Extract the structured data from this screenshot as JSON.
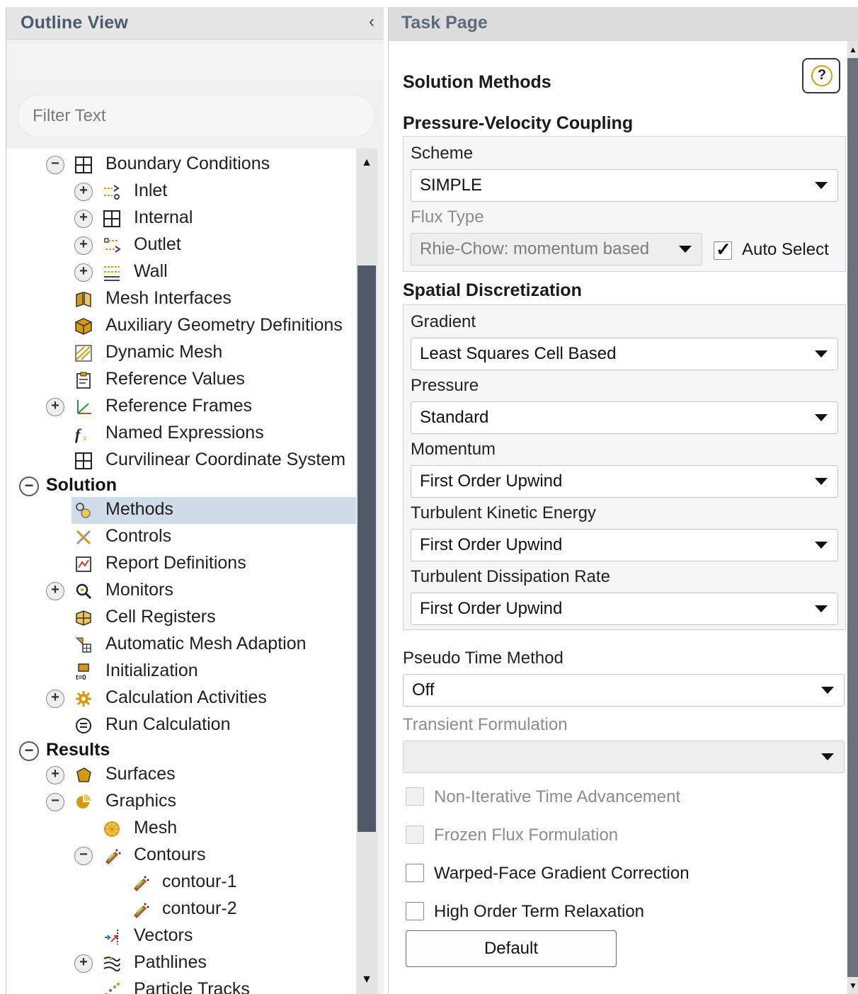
{
  "outline": {
    "title": "Outline View",
    "collapse_glyph": "‹",
    "filter_placeholder": "Filter Text",
    "tree": [
      {
        "label": "Boundary Conditions",
        "level": 1,
        "expander": "−",
        "icon": "grid-icon"
      },
      {
        "label": "Inlet",
        "level": 2,
        "expander": "+",
        "icon": "inlet-icon"
      },
      {
        "label": "Internal",
        "level": 2,
        "expander": "+",
        "icon": "grid-icon"
      },
      {
        "label": "Outlet",
        "level": 2,
        "expander": "+",
        "icon": "outlet-icon"
      },
      {
        "label": "Wall",
        "level": 2,
        "expander": "+",
        "icon": "wall-icon"
      },
      {
        "label": "Mesh Interfaces",
        "level": 1,
        "expander": "",
        "icon": "mesh-interfaces-icon"
      },
      {
        "label": "Auxiliary Geometry Definitions",
        "level": 1,
        "expander": "",
        "icon": "cube-icon"
      },
      {
        "label": "Dynamic Mesh",
        "level": 1,
        "expander": "",
        "icon": "dynamic-mesh-icon"
      },
      {
        "label": "Reference Values",
        "level": 1,
        "expander": "",
        "icon": "clipboard-icon"
      },
      {
        "label": "Reference Frames",
        "level": 1,
        "expander": "+",
        "icon": "axes-icon"
      },
      {
        "label": "Named Expressions",
        "level": 1,
        "expander": "",
        "icon": "function-icon"
      },
      {
        "label": "Curvilinear Coordinate System",
        "level": 1,
        "expander": "",
        "icon": "grid-icon"
      },
      {
        "label": "Solution",
        "level": 0,
        "expander": "−",
        "icon": "",
        "bold": true
      },
      {
        "label": "Methods",
        "level": 1,
        "expander": "",
        "icon": "methods-icon",
        "selected": true
      },
      {
        "label": "Controls",
        "level": 1,
        "expander": "",
        "icon": "controls-icon"
      },
      {
        "label": "Report Definitions",
        "level": 1,
        "expander": "",
        "icon": "report-icon"
      },
      {
        "label": "Monitors",
        "level": 1,
        "expander": "+",
        "icon": "magnifier-icon"
      },
      {
        "label": "Cell Registers",
        "level": 1,
        "expander": "",
        "icon": "cell-registers-icon"
      },
      {
        "label": "Automatic Mesh Adaption",
        "level": 1,
        "expander": "",
        "icon": "mesh-adaption-icon"
      },
      {
        "label": "Initialization",
        "level": 1,
        "expander": "",
        "icon": "initialization-icon"
      },
      {
        "label": "Calculation Activities",
        "level": 1,
        "expander": "+",
        "icon": "gear-icon"
      },
      {
        "label": "Run Calculation",
        "level": 1,
        "expander": "",
        "icon": "run-icon"
      },
      {
        "label": "Results",
        "level": 0,
        "expander": "−",
        "icon": "",
        "bold": true
      },
      {
        "label": "Surfaces",
        "level": 1,
        "expander": "+",
        "icon": "surface-icon"
      },
      {
        "label": "Graphics",
        "level": 1,
        "expander": "−",
        "icon": "graphics-icon"
      },
      {
        "label": "Mesh",
        "level": 2,
        "expander": "",
        "icon": "mesh-ball-icon"
      },
      {
        "label": "Contours",
        "level": 2,
        "expander": "−",
        "icon": "contour-icon"
      },
      {
        "label": "contour-1",
        "level": 3,
        "expander": "",
        "icon": "contour-icon"
      },
      {
        "label": "contour-2",
        "level": 3,
        "expander": "",
        "icon": "contour-icon"
      },
      {
        "label": "Vectors",
        "level": 2,
        "expander": "",
        "icon": "vectors-icon"
      },
      {
        "label": "Pathlines",
        "level": 2,
        "expander": "+",
        "icon": "pathlines-icon"
      },
      {
        "label": "Particle Tracks",
        "level": 2,
        "expander": "",
        "icon": "particle-tracks-icon"
      }
    ]
  },
  "task": {
    "title": "Task Page",
    "section_title": "Solution Methods",
    "help_glyph": "?",
    "pv_coupling": {
      "title": "Pressure-Velocity Coupling",
      "scheme_label": "Scheme",
      "scheme_value": "SIMPLE",
      "flux_label": "Flux Type",
      "flux_value": "Rhie-Chow: momentum based",
      "auto_select_label": "Auto Select",
      "auto_select_checked": true
    },
    "spatial": {
      "title": "Spatial Discretization",
      "fields": [
        {
          "label": "Gradient",
          "value": "Least Squares Cell Based"
        },
        {
          "label": "Pressure",
          "value": "Standard"
        },
        {
          "label": "Momentum",
          "value": "First Order Upwind"
        },
        {
          "label": "Turbulent Kinetic Energy",
          "value": "First Order Upwind"
        },
        {
          "label": "Turbulent Dissipation Rate",
          "value": "First Order Upwind"
        }
      ]
    },
    "pseudo_time": {
      "label": "Pseudo Time Method",
      "value": "Off"
    },
    "transient": {
      "label": "Transient Formulation",
      "value": ""
    },
    "options": [
      {
        "label": "Non-Iterative Time Advancement",
        "checked": false,
        "disabled": true
      },
      {
        "label": "Frozen Flux Formulation",
        "checked": false,
        "disabled": true
      },
      {
        "label": "Warped-Face Gradient Correction",
        "checked": false,
        "disabled": false
      },
      {
        "label": "High Order Term Relaxation",
        "checked": false,
        "disabled": false
      }
    ],
    "default_button": "Default"
  },
  "colors": {
    "accent_title": "#4a5b6e",
    "selected_row": "#cfdcea",
    "scroll_thumb": "#505a66",
    "help_ring": "#d49a10"
  }
}
